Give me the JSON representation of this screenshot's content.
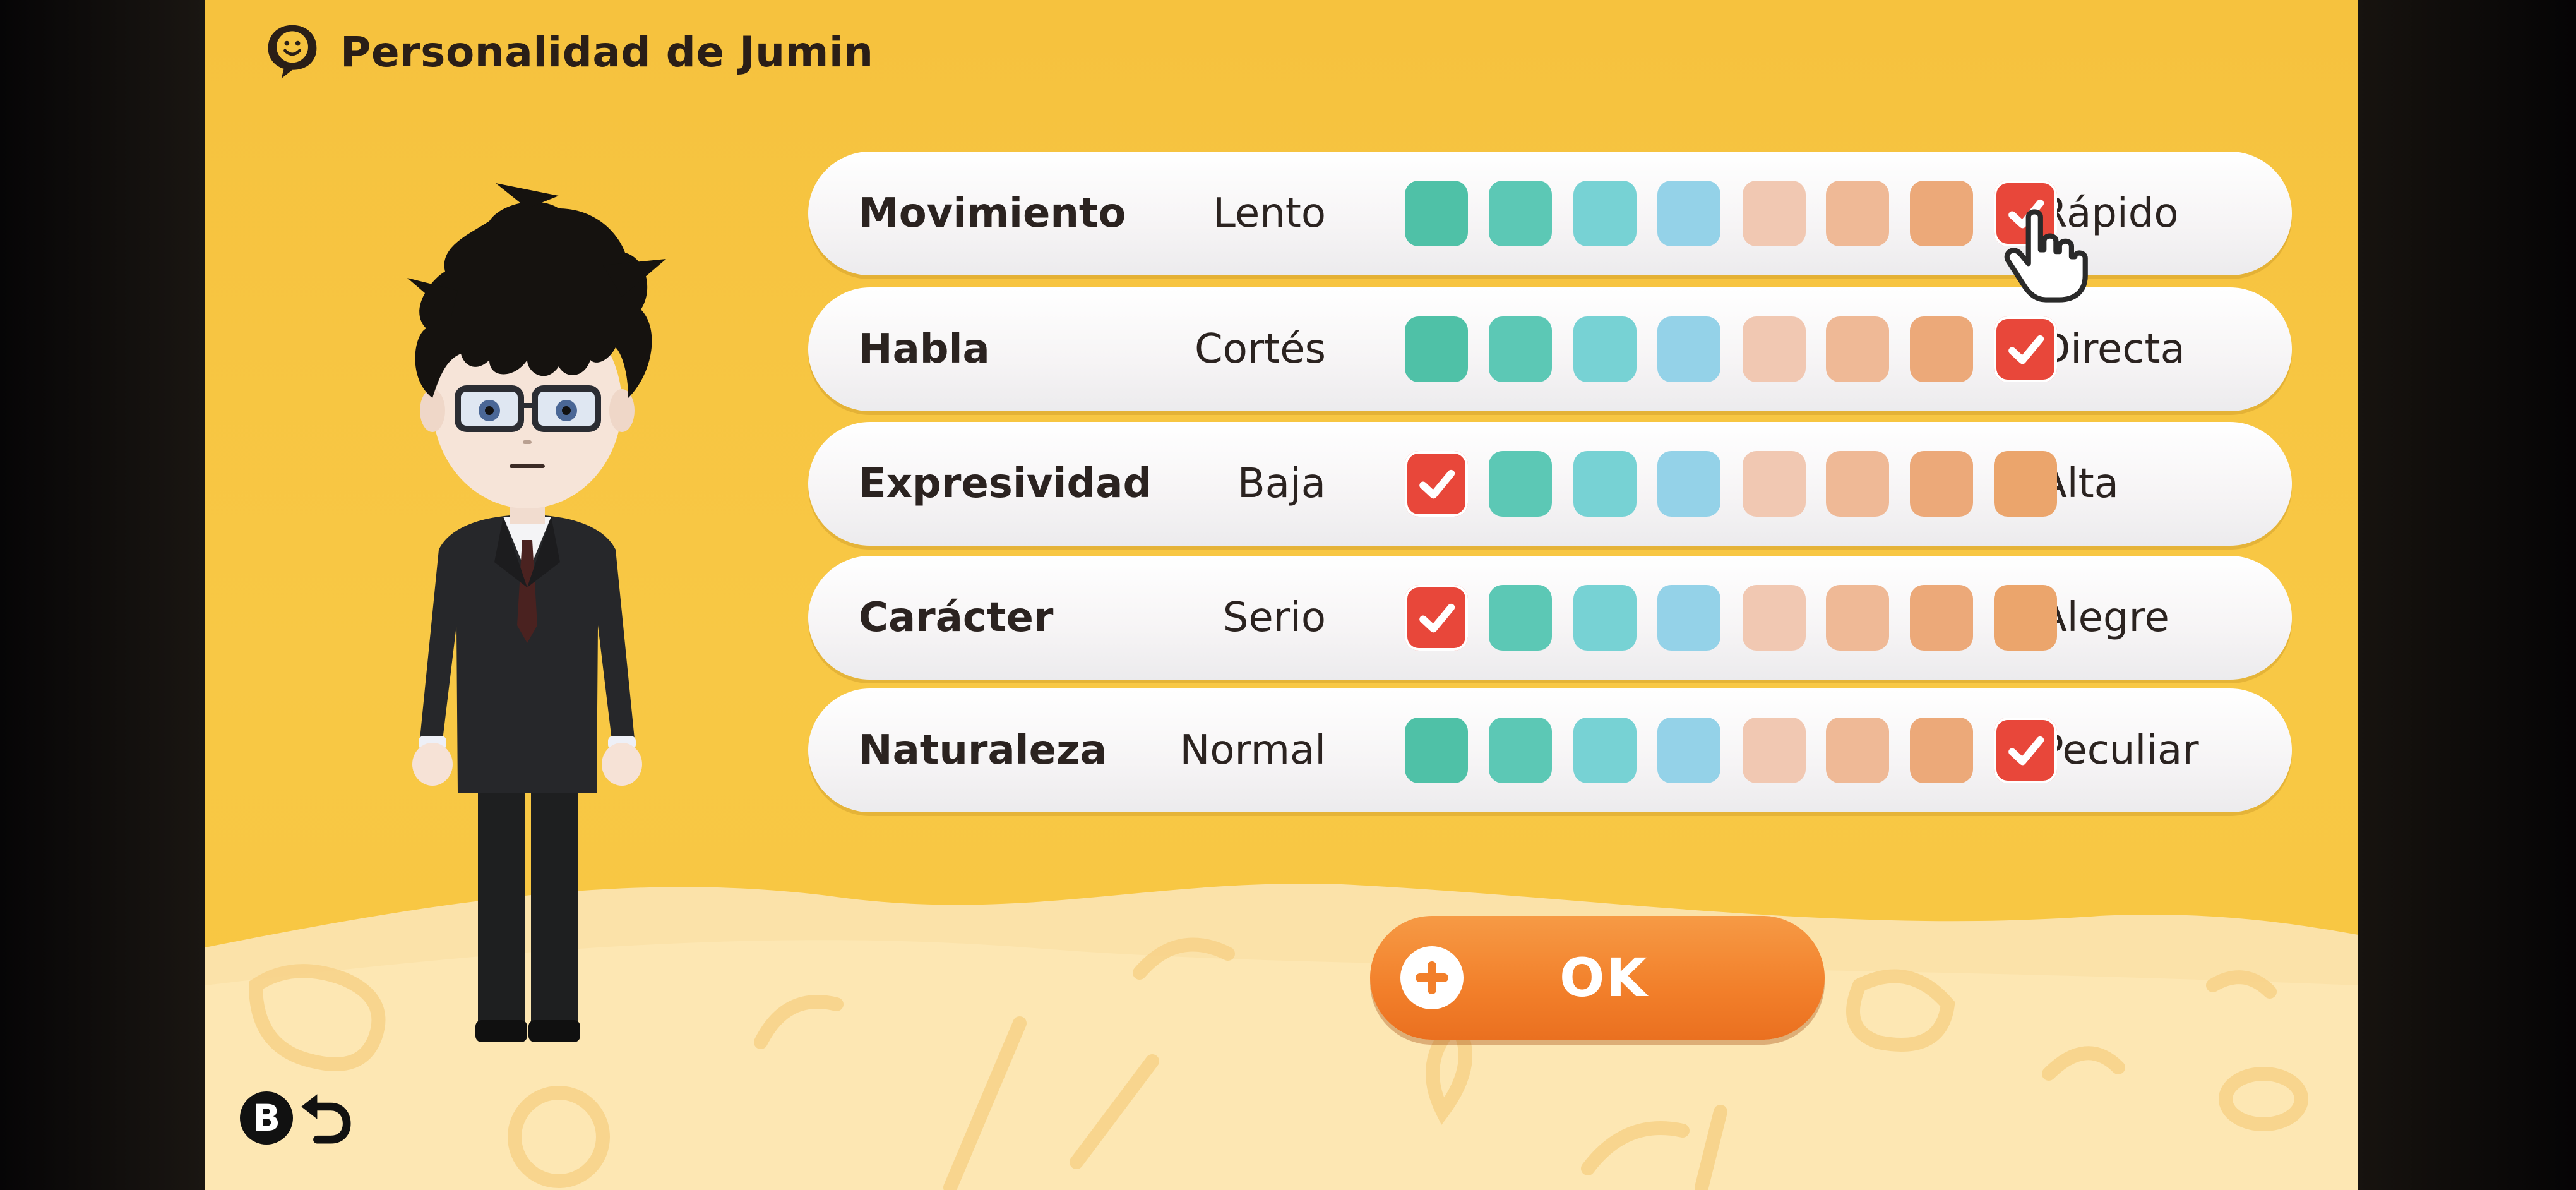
{
  "header": {
    "title": "Personalidad de Jumin",
    "icon": "speech-heart-icon"
  },
  "character": {
    "name": "Jumin",
    "icon": "mii-character"
  },
  "colors": {
    "cells": [
      "#4fc1a7",
      "#5cc8b5",
      "#77d2d4",
      "#94d2e8",
      "#f1c8b2",
      "#efb996",
      "#eca979",
      "#eba56c"
    ],
    "selected": "#e8473a",
    "background": "#f6c23e",
    "ok_button": "#f27f2a"
  },
  "traits": [
    {
      "label": "Movimiento",
      "low": "Lento",
      "high": "Rápido",
      "selected": 8
    },
    {
      "label": "Habla",
      "low": "Cortés",
      "high": "Directa",
      "selected": 8
    },
    {
      "label": "Expresividad",
      "low": "Baja",
      "high": "Alta",
      "selected": 1
    },
    {
      "label": "Carácter",
      "low": "Serio",
      "high": "Alegre",
      "selected": 1
    },
    {
      "label": "Naturaleza",
      "low": "Normal",
      "high": "Peculiar",
      "selected": 8
    }
  ],
  "scale_steps": 8,
  "ok_button": {
    "label": "OK",
    "icon": "plus-button-icon"
  },
  "back_hint": {
    "button": "B",
    "icon": "back-arrow-icon"
  },
  "cursor": {
    "icon": "hand-pointer-icon",
    "over": "Movimiento"
  }
}
